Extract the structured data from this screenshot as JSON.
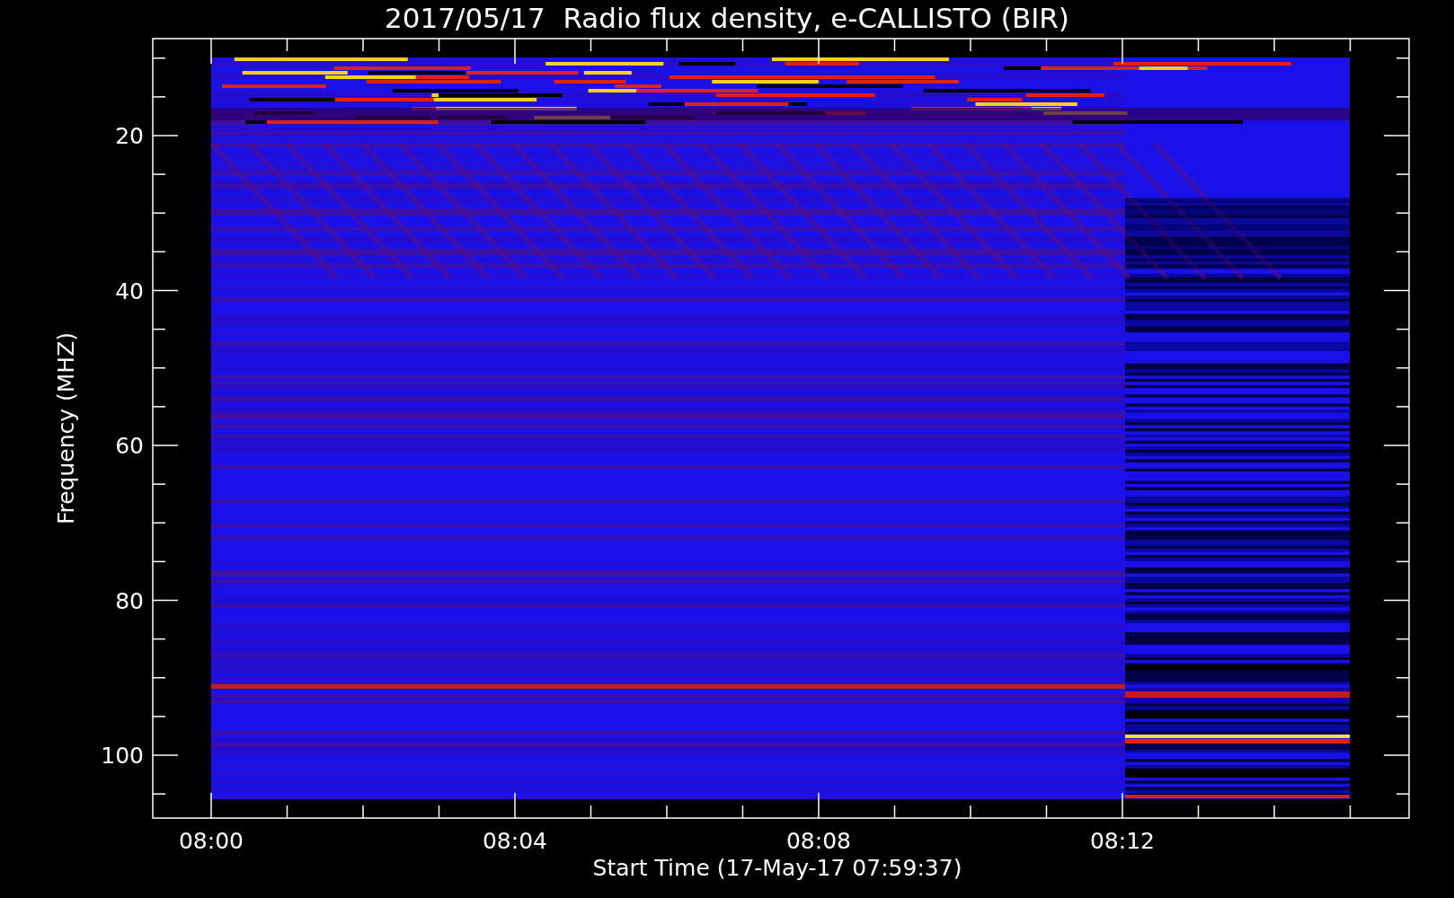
{
  "title": "2017/05/17  Radio flux density, e-CALLISTO (BIR)",
  "y_axis": {
    "label": "Frequency (MHZ)",
    "ticks": [
      "20",
      "40",
      "60",
      "80",
      "100"
    ]
  },
  "x_axis": {
    "label": "Start Time (17-May-17 07:59:37)",
    "ticks": [
      "08:00",
      "08:04",
      "08:08",
      "08:12"
    ]
  }
}
